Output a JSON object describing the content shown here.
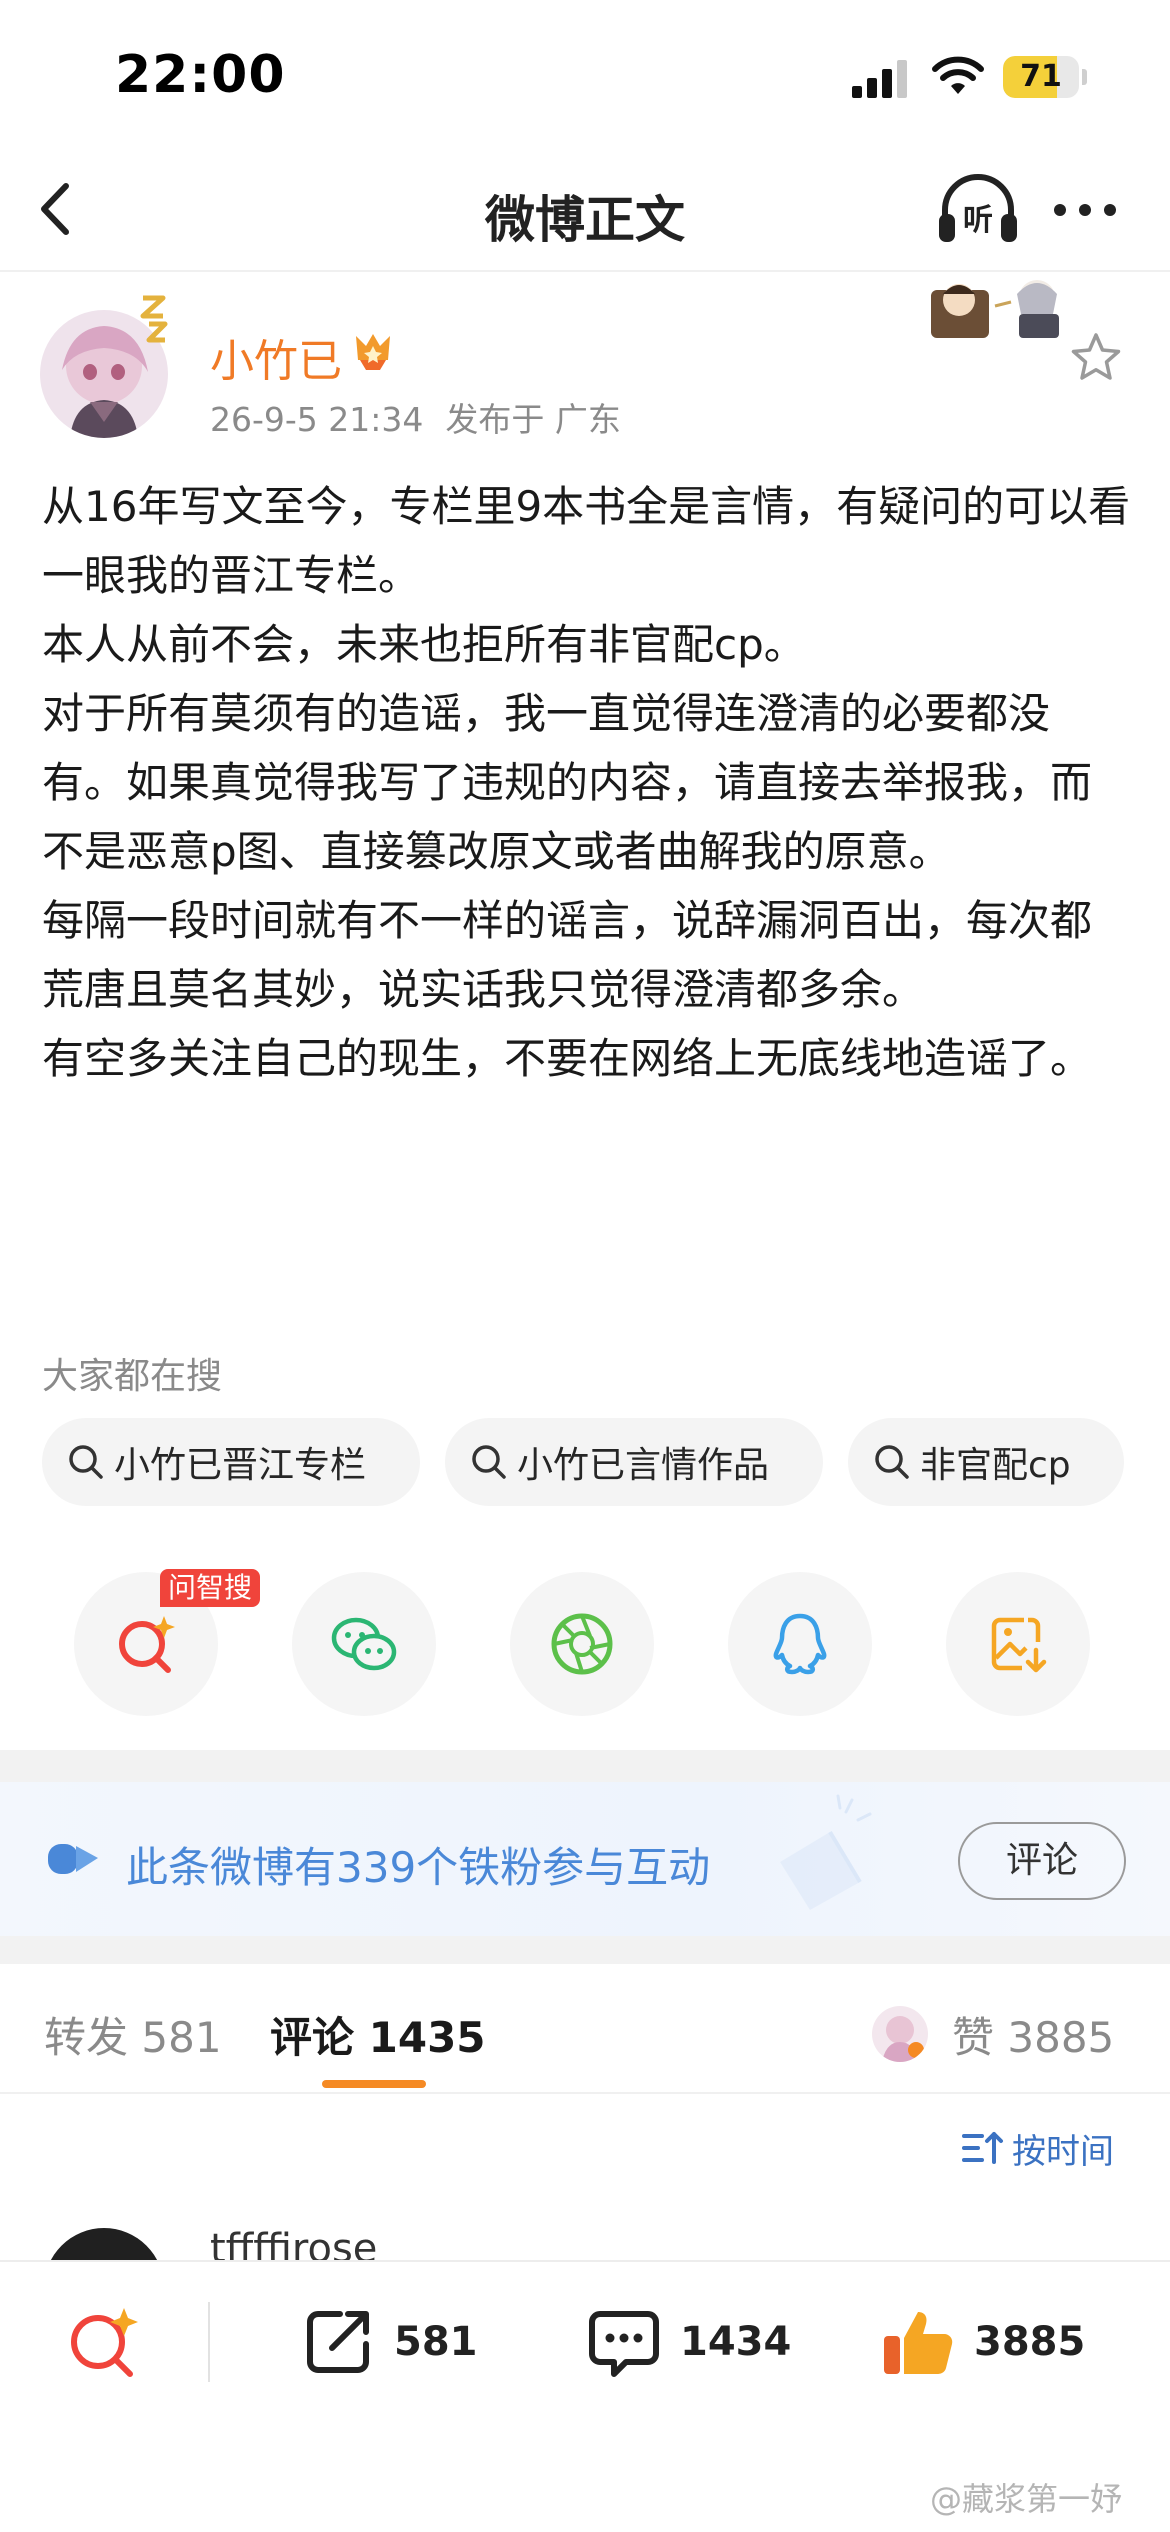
{
  "status_bar": {
    "time": "22:00",
    "battery": "71",
    "battery_level": 0.71
  },
  "nav": {
    "title": "微博正文"
  },
  "author": {
    "name": "小竹已",
    "timestamp": "26-9-5 21:34",
    "location": "发布于 广东"
  },
  "post": {
    "paragraphs": [
      "从16年写文至今，专栏里9本书全是言情，有疑问的可以看一眼我的晋江专栏。",
      "本人从前不会，未来也拒所有非官配cp。",
      "对于所有莫须有的造谣，我一直觉得连澄清的必要都没有。如果真觉得我写了违规的内容，请直接去举报我，而不是恶意p图、直接篡改原文或者曲解我的原意。",
      "每隔一段时间就有不一样的谣言，说辞漏洞百出，每次都荒唐且莫名其妙，说实话我只觉得澄清都多余。",
      "有空多关注自己的现生，不要在网络上无底线地造谣了。"
    ]
  },
  "hot_search": {
    "title": "大家都在搜",
    "chips": [
      "小竹已晋江专栏",
      "小竹已言情作品",
      "非官配cp"
    ]
  },
  "share": {
    "ai_tag": "问智搜",
    "icons": [
      "ai-search-icon",
      "wechat-icon",
      "moments-icon",
      "qq-icon",
      "save-image-icon"
    ]
  },
  "fans_banner": {
    "text": "此条微博有339个铁粉参与互动",
    "button": "评论"
  },
  "tabs": {
    "repost_label": "转发",
    "repost_count": "581",
    "comment_label": "评论",
    "comment_count": "1435",
    "like_label": "赞",
    "like_count": "3885"
  },
  "sort": {
    "label": "按时间"
  },
  "comment_peek": {
    "name": "tffffirose"
  },
  "bottom_bar": {
    "repost_count": "581",
    "comment_count": "1434",
    "like_count": "3885"
  },
  "watermark": "@藏浆第一妤",
  "colors": {
    "accent_orange": "#f07a26",
    "link_blue": "#3b72c2",
    "banner_blue": "#4a88d8",
    "tag_red": "#f0443b"
  }
}
